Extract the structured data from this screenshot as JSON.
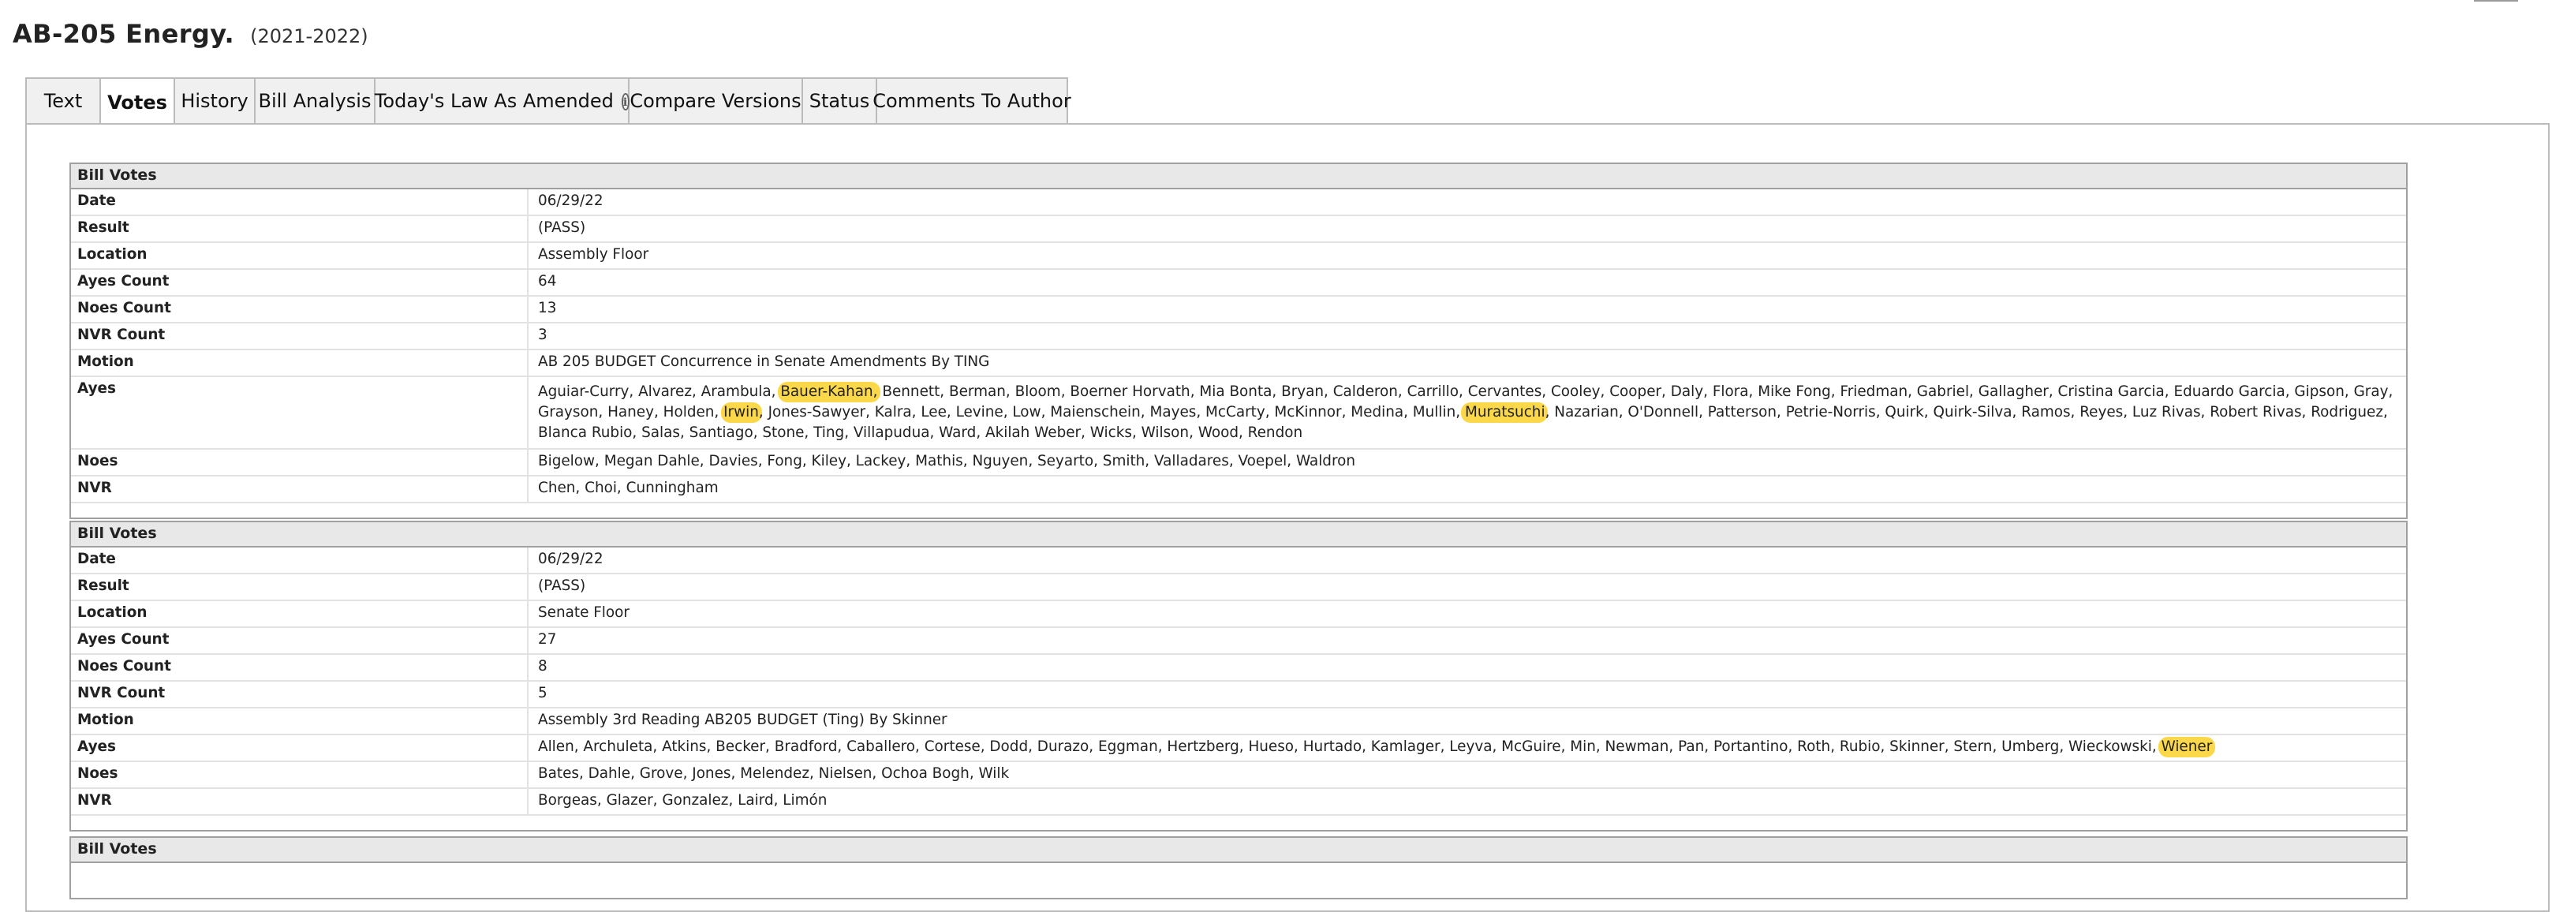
{
  "page": {
    "title": "AB-205 Energy.",
    "session": "(2021-2022)"
  },
  "tabs": [
    {
      "label": "Text"
    },
    {
      "label": "Votes"
    },
    {
      "label": "History"
    },
    {
      "label": "Bill Analysis"
    },
    {
      "label": "Today's Law As Amended"
    },
    {
      "label": "Compare Versions"
    },
    {
      "label": "Status"
    },
    {
      "label": "Comments To Author"
    }
  ],
  "labels": {
    "date": "Date",
    "result": "Result",
    "location": "Location",
    "ayes_count": "Ayes Count",
    "noes_count": "Noes Count",
    "nvr_count": "NVR Count",
    "motion": "Motion",
    "ayes": "Ayes",
    "noes": "Noes",
    "nvr": "NVR"
  },
  "highlight_color": "#fbd84a",
  "votes": [
    {
      "header": "Bill Votes",
      "date": "06/29/22",
      "result": "(PASS)",
      "location": "Assembly Floor",
      "ayes_count": "64",
      "noes_count": "13",
      "nvr_count": "3",
      "motion": "AB 205 BUDGET Concurrence in Senate Amendments By TING",
      "ayes_segments": [
        {
          "t": "Aguiar-Curry, Alvarez, Arambula, "
        },
        {
          "t": "Bauer-Kahan,",
          "hl": true
        },
        {
          "t": " Bennett, Berman, Bloom, Boerner Horvath, Mia Bonta, Bryan, Calderon, Carrillo, Cervantes, Cooley, Cooper, Daly, Flora, Mike Fong, Friedman, Gabriel, Gallagher, Cristina Garcia, Eduardo Garcia, Gipson, Gray, Grayson, Haney, Holden, "
        },
        {
          "t": "Irwin",
          "hl": true
        },
        {
          "t": ", Jones-Sawyer, Kalra, Lee, Levine, Low, Maienschein, Mayes, McCarty, McKinnor, Medina, Mullin, "
        },
        {
          "t": "Muratsuchi",
          "hl": true
        },
        {
          "t": ", Nazarian, O'Donnell, Patterson, Petrie-Norris, Quirk, Quirk-Silva, Ramos, Reyes, Luz Rivas, Robert Rivas, Rodriguez, Blanca Rubio, Salas, Santiago, Stone, Ting, Villapudua, Ward, Akilah Weber, Wicks, Wilson, Wood, Rendon"
        }
      ],
      "noes": "Bigelow, Megan Dahle, Davies, Fong, Kiley, Lackey, Mathis, Nguyen, Seyarto, Smith, Valladares, Voepel, Waldron",
      "nvr": "Chen, Choi, Cunningham"
    },
    {
      "header": "Bill Votes",
      "date": "06/29/22",
      "result": "(PASS)",
      "location": "Senate Floor",
      "ayes_count": "27",
      "noes_count": "8",
      "nvr_count": "5",
      "motion": "Assembly 3rd Reading AB205 BUDGET (Ting) By Skinner",
      "ayes_segments": [
        {
          "t": "Allen, Archuleta, Atkins, Becker, Bradford, Caballero, Cortese, Dodd, Durazo, Eggman, Hertzberg, Hueso, Hurtado, Kamlager, Leyva, McGuire, Min, Newman, Pan, Portantino, Roth, Rubio, Skinner, Stern, Umberg, Wieckowski, "
        },
        {
          "t": "Wiener",
          "hl": true
        }
      ],
      "noes": "Bates, Dahle, Grove, Jones, Melendez, Nielsen, Ochoa Bogh, Wilk",
      "nvr": "Borgeas, Glazer, Gonzalez, Laird, Limón"
    },
    {
      "header": "Bill Votes"
    }
  ]
}
